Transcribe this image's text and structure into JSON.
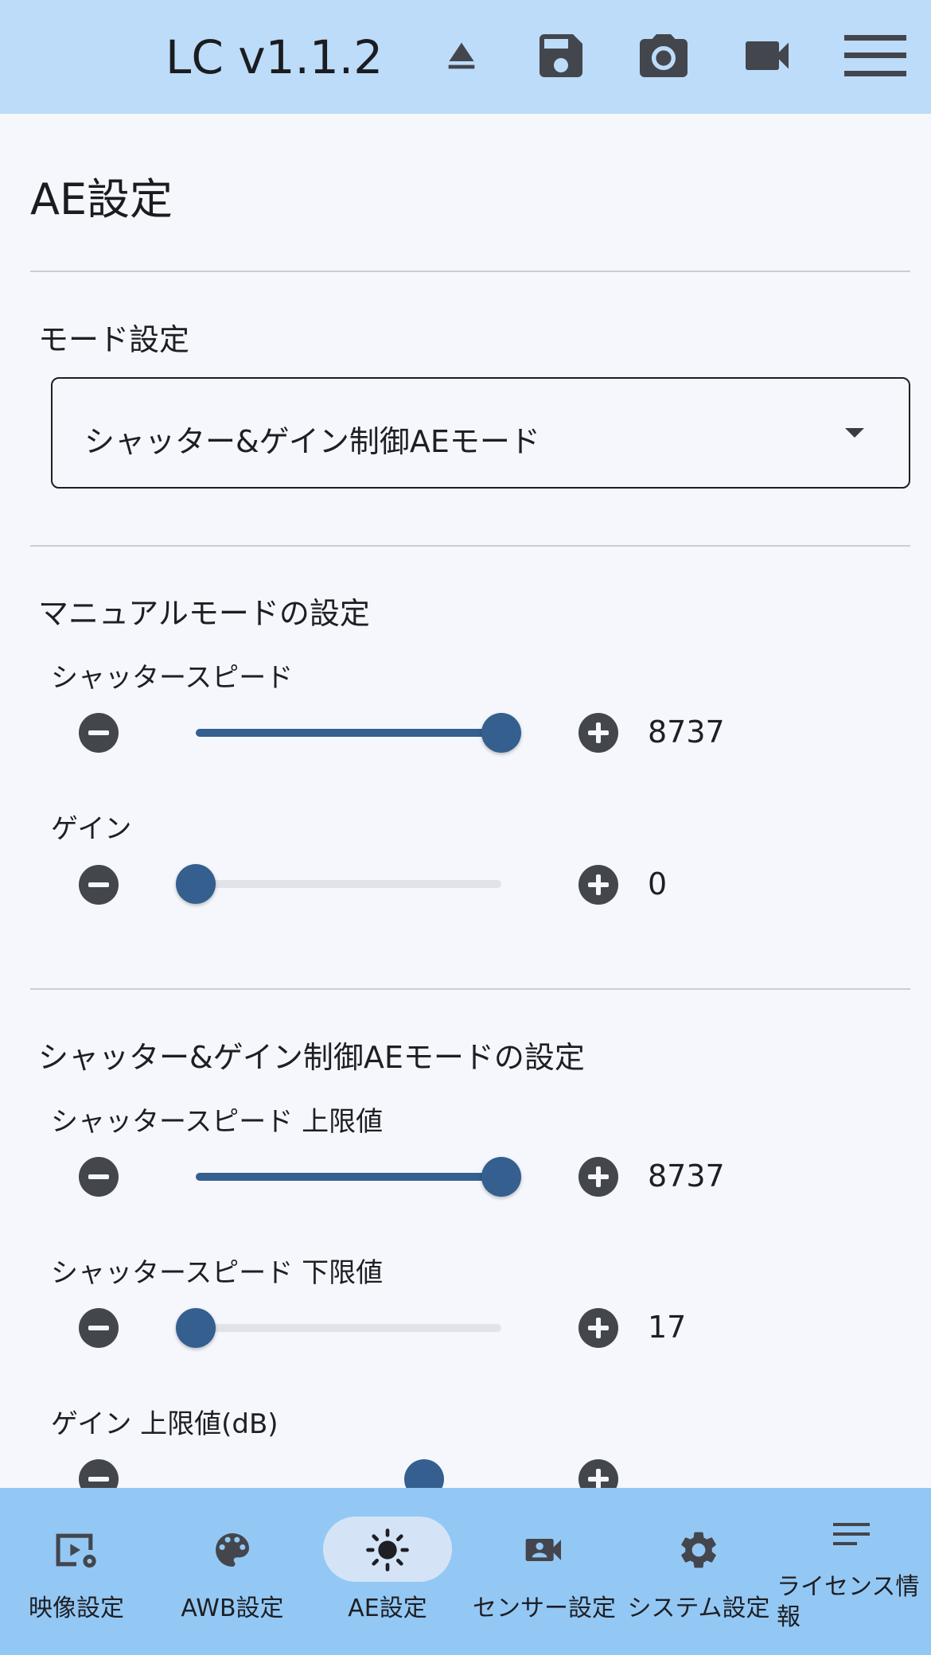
{
  "header": {
    "title": "LC v1.1.2",
    "icons": [
      "eject-icon",
      "save-icon",
      "camera-icon",
      "video-camera-icon",
      "menu-icon"
    ]
  },
  "page": {
    "title": "AE設定"
  },
  "mode_section": {
    "label": "モード設定",
    "selected_mode": "シャッター&ゲイン制御AEモード"
  },
  "manual_section": {
    "label": "マニュアルモードの設定",
    "sliders": [
      {
        "label": "シャッタースピード",
        "value": "8737",
        "fraction": 1.0
      },
      {
        "label": "ゲイン",
        "value": "0",
        "fraction": 0.0
      }
    ]
  },
  "ae_section": {
    "label": "シャッター&ゲイン制御AEモードの設定",
    "sliders": [
      {
        "label": "シャッタースピード 上限値",
        "value": "8737",
        "fraction": 1.0
      },
      {
        "label": "シャッタースピード 下限値",
        "value": "17",
        "fraction": 0.0
      },
      {
        "label": "ゲイン 上限値(dB)"
      }
    ]
  },
  "nav": {
    "items": [
      {
        "label": "映像設定",
        "icon": "video-settings-icon"
      },
      {
        "label": "AWB設定",
        "icon": "palette-icon"
      },
      {
        "label": "AE設定",
        "icon": "brightness-icon",
        "active": true
      },
      {
        "label": "センサー設定",
        "icon": "video-camera-account-icon"
      },
      {
        "label": "システム設定",
        "icon": "gear-icon"
      },
      {
        "label": "ライセンス情報",
        "icon": "notes-icon"
      }
    ]
  },
  "colors": {
    "header_bg": "#bcdcf9",
    "nav_bg": "#94c8f4",
    "accent": "#345f8e",
    "background": "#f5f7fc"
  }
}
